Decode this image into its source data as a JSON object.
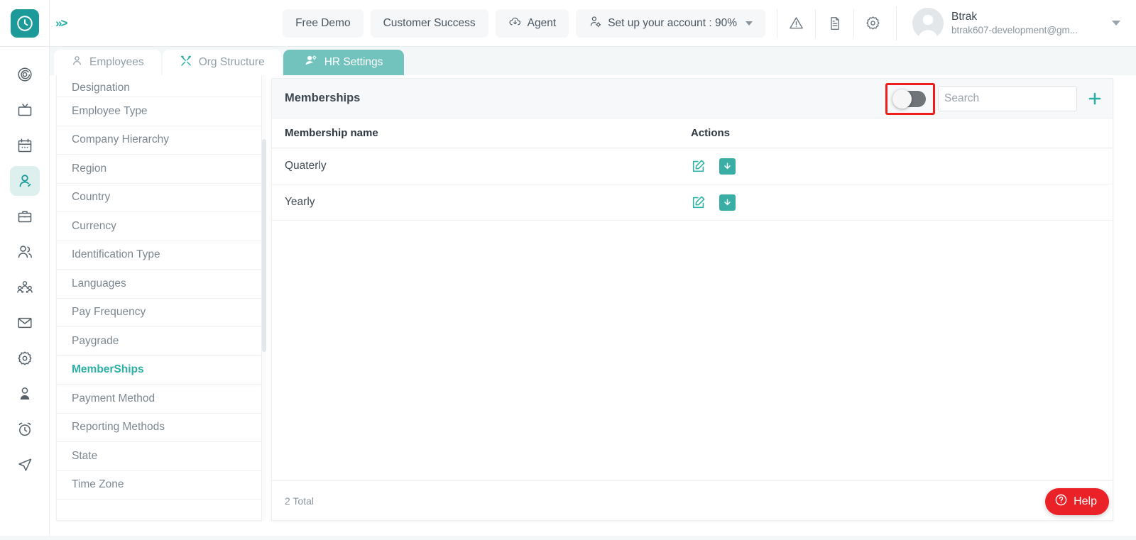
{
  "header": {
    "logo_icon": "clock-logo-icon",
    "expand_icon": "chevron-double-right-icon",
    "buttons": [
      {
        "label": "Free Demo",
        "icon": null,
        "name": "free-demo-button"
      },
      {
        "label": "Customer Success",
        "icon": null,
        "name": "customer-success-button"
      },
      {
        "label": "Agent",
        "icon": "cloud-download-icon",
        "name": "agent-button"
      },
      {
        "label": "Set up your account : 90%",
        "icon": "person-gear-icon",
        "name": "setup-account-button",
        "caret": true
      }
    ],
    "icons": [
      {
        "name": "warning-triangle-icon"
      },
      {
        "name": "document-icon"
      },
      {
        "name": "gear-icon"
      }
    ],
    "user": {
      "name": "Btrak",
      "email": "btrak607-development@gm...",
      "avatar_icon": "avatar-icon",
      "caret_icon": "chevron-down-icon"
    }
  },
  "rail": {
    "items": [
      {
        "name": "target-icon",
        "active": false
      },
      {
        "name": "tv-icon",
        "active": false
      },
      {
        "name": "calendar-icon",
        "active": false
      },
      {
        "name": "person-icon",
        "active": true
      },
      {
        "name": "briefcase-icon",
        "active": false
      },
      {
        "name": "people-icon",
        "active": false
      },
      {
        "name": "group-org-icon",
        "active": false
      },
      {
        "name": "mail-icon",
        "active": false
      },
      {
        "name": "settings-gear-icon",
        "active": false
      },
      {
        "name": "user-profile-icon",
        "active": false
      },
      {
        "name": "alarm-clock-icon",
        "active": false
      },
      {
        "name": "send-navigate-icon",
        "active": false
      }
    ]
  },
  "tabs": [
    {
      "label": "Employees",
      "icon": "person-outline-icon",
      "active": false
    },
    {
      "label": "Org Structure",
      "icon": "tools-icon",
      "active": false
    },
    {
      "label": "HR Settings",
      "icon": "users-gear-icon",
      "active": true
    }
  ],
  "settings_list": {
    "items": [
      {
        "label": "Designation",
        "active": false
      },
      {
        "label": "Employee Type",
        "active": false
      },
      {
        "label": "Company Hierarchy",
        "active": false
      },
      {
        "label": "Region",
        "active": false
      },
      {
        "label": "Country",
        "active": false
      },
      {
        "label": "Currency",
        "active": false
      },
      {
        "label": "Identification Type",
        "active": false
      },
      {
        "label": "Languages",
        "active": false
      },
      {
        "label": "Pay Frequency",
        "active": false
      },
      {
        "label": "Paygrade",
        "active": false
      },
      {
        "label": "MemberShips",
        "active": true
      },
      {
        "label": "Payment Method",
        "active": false
      },
      {
        "label": "Reporting Methods",
        "active": false
      },
      {
        "label": "State",
        "active": false
      },
      {
        "label": "Time Zone",
        "active": false
      }
    ]
  },
  "panel": {
    "title": "Memberships",
    "toggle": {
      "name": "archive-toggle",
      "state": "off",
      "highlighted": true
    },
    "search": {
      "placeholder": "Search",
      "value": ""
    },
    "add_icon": "plus-icon",
    "columns": [
      "Membership name",
      "Actions"
    ],
    "rows": [
      {
        "name": "Quaterly",
        "actions": [
          "edit-icon",
          "archive-icon"
        ]
      },
      {
        "name": "Yearly",
        "actions": [
          "edit-icon",
          "archive-icon"
        ]
      }
    ],
    "footer_total": "2 Total"
  },
  "help": {
    "label": "Help",
    "icon": "question-circle-icon"
  },
  "colors": {
    "teal": "#2bb0a6",
    "teal_dark": "#1c9a99",
    "tab_active": "#72c3bd",
    "help_red": "#ea2127",
    "highlight_red": "#f01d1d"
  }
}
